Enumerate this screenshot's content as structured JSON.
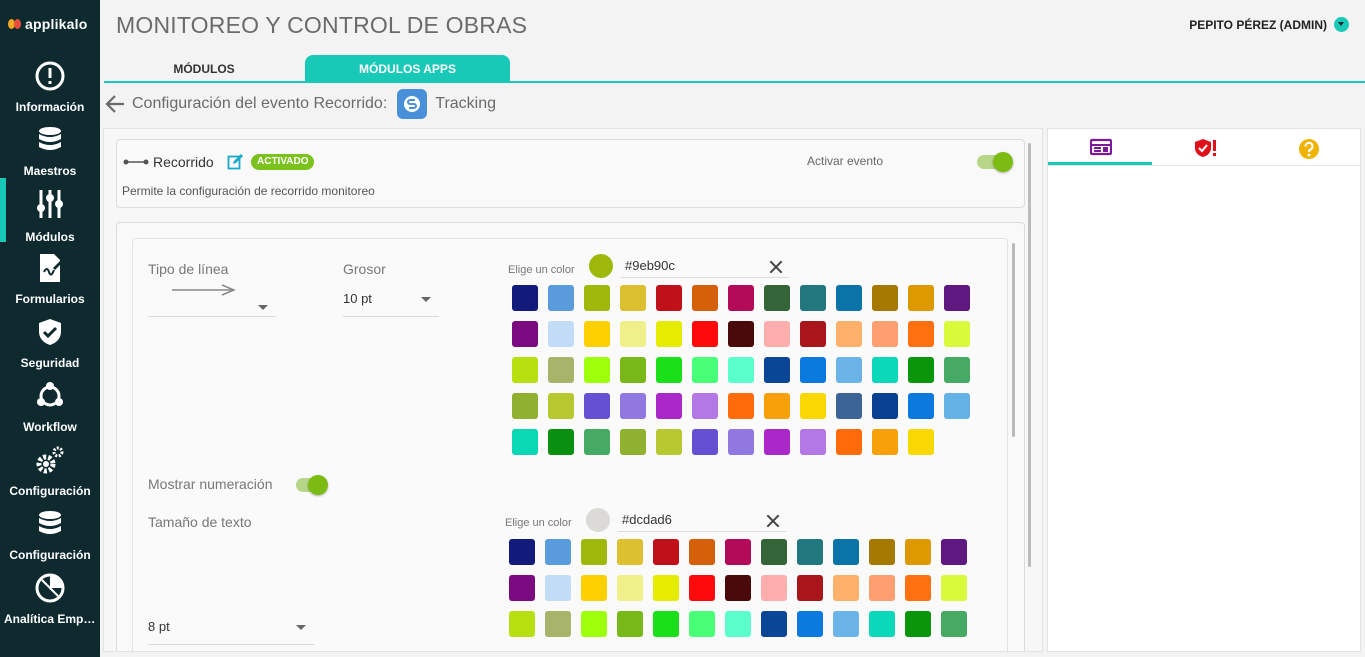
{
  "app": {
    "logo_text": "applikalo",
    "title": "MONITOREO Y CONTROL DE OBRAS",
    "user": "PEPITO PÉREZ (ADMIN)"
  },
  "sidebar": {
    "items": [
      {
        "label": "Información",
        "icon": "info-icon"
      },
      {
        "label": "Maestros",
        "icon": "database-icon"
      },
      {
        "label": "Módulos",
        "icon": "sliders-icon",
        "active": true
      },
      {
        "label": "Formularios",
        "icon": "form-icon"
      },
      {
        "label": "Seguridad",
        "icon": "shield-check-icon"
      },
      {
        "label": "Workflow",
        "icon": "workflow-icon"
      },
      {
        "label": "Configuración",
        "icon": "gears-icon"
      },
      {
        "label": "Configuración",
        "icon": "database-icon"
      },
      {
        "label": "Analítica Empresarial",
        "icon": "chart-pie-icon"
      }
    ]
  },
  "tabs": [
    {
      "label": "MÓDULOS"
    },
    {
      "label": "MÓDULOS APPS",
      "active": true
    }
  ],
  "breadcrumb": {
    "text": "Configuración del evento Recorrido:",
    "module": "Tracking"
  },
  "event": {
    "name": "Recorrido",
    "badge": "ACTIVADO",
    "activate_label": "Activar evento",
    "activate_on": true,
    "description": "Permite la configuración de recorrido monitoreo"
  },
  "config": {
    "line_type_label": "Tipo de línea",
    "thickness_label": "Grosor",
    "thickness_value": "10 pt",
    "show_numbering_label": "Mostrar numeración",
    "show_numbering_on": true,
    "text_size_label": "Tamaño de texto",
    "text_size_value": "8 pt",
    "picker1": {
      "label": "Elige un color",
      "value": "#9eb90c"
    },
    "picker2": {
      "label": "Elige un color",
      "value": "#dcdad6"
    },
    "palette": [
      "#131b7a",
      "#5a9bdc",
      "#9eb90c",
      "#dcc030",
      "#c0101a",
      "#d65f0a",
      "#b40a5a",
      "#346538",
      "#237880",
      "#0a73a8",
      "#a57800",
      "#dc9a00",
      "#5e1880",
      "#7a0a80",
      "#c2dcf8",
      "#ffd000",
      "#eff08a",
      "#e5ec00",
      "#ff0a0a",
      "#4a0a0a",
      "#ffadad",
      "#a8161c",
      "#ffb06a",
      "#ff9e70",
      "#ff7010",
      "#d8fa3a",
      "#b8e010",
      "#a8b46a",
      "#9eff0a",
      "#78b818",
      "#1ae01a",
      "#4aff78",
      "#5affcc",
      "#0a4696",
      "#0a7ade",
      "#6ab4e8",
      "#0ad8b8",
      "#0a960a",
      "#46aa64",
      "#90b030",
      "#b8c830",
      "#6450d0",
      "#9078e0",
      "#aa28c8",
      "#b478e6",
      "#ff6a0a",
      "#f8a00a",
      "#f8d800",
      "#3c6496",
      "#0a4090",
      "#0a78dc",
      "#64b2e6",
      "#0ad8b4",
      "#0a9010",
      "#46aa64",
      "#90b030",
      "#b8c830",
      "#6450d0",
      "#9078e0",
      "#aa28c8",
      "#b478e6",
      "#ff6a0a",
      "#f8a00a",
      "#f8d800"
    ],
    "palette2_rows": 3
  },
  "side_tabs": [
    {
      "icon": "card-icon",
      "color": "#7a1a9a",
      "active": true
    },
    {
      "icon": "shield-alert-icon",
      "color": "#e0101a"
    },
    {
      "icon": "help-icon",
      "color": "#f0b400"
    }
  ]
}
